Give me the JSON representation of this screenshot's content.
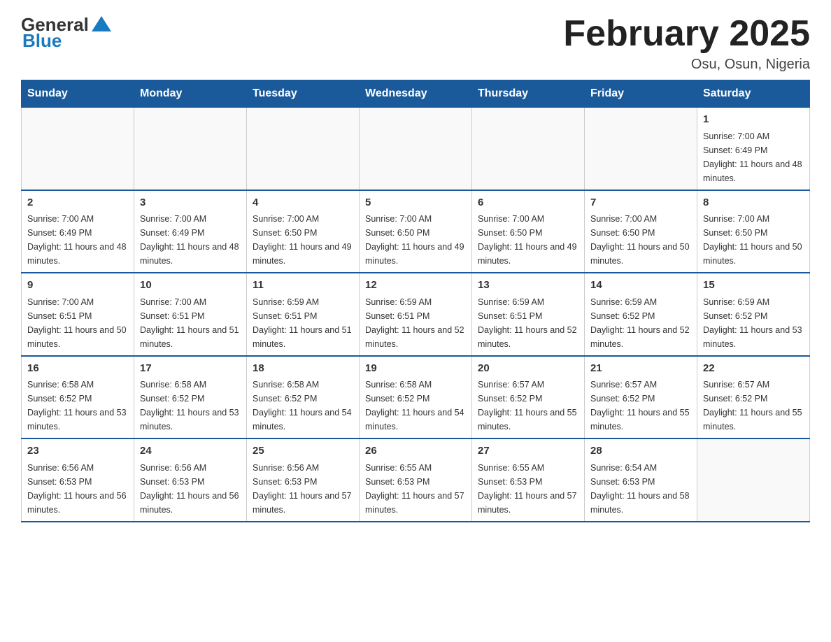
{
  "logo": {
    "general": "General",
    "blue": "Blue"
  },
  "title": "February 2025",
  "subtitle": "Osu, Osun, Nigeria",
  "days": [
    "Sunday",
    "Monday",
    "Tuesday",
    "Wednesday",
    "Thursday",
    "Friday",
    "Saturday"
  ],
  "weeks": [
    [
      {
        "day": "",
        "sunrise": "",
        "sunset": "",
        "daylight": ""
      },
      {
        "day": "",
        "sunrise": "",
        "sunset": "",
        "daylight": ""
      },
      {
        "day": "",
        "sunrise": "",
        "sunset": "",
        "daylight": ""
      },
      {
        "day": "",
        "sunrise": "",
        "sunset": "",
        "daylight": ""
      },
      {
        "day": "",
        "sunrise": "",
        "sunset": "",
        "daylight": ""
      },
      {
        "day": "",
        "sunrise": "",
        "sunset": "",
        "daylight": ""
      },
      {
        "day": "1",
        "sunrise": "Sunrise: 7:00 AM",
        "sunset": "Sunset: 6:49 PM",
        "daylight": "Daylight: 11 hours and 48 minutes."
      }
    ],
    [
      {
        "day": "2",
        "sunrise": "Sunrise: 7:00 AM",
        "sunset": "Sunset: 6:49 PM",
        "daylight": "Daylight: 11 hours and 48 minutes."
      },
      {
        "day": "3",
        "sunrise": "Sunrise: 7:00 AM",
        "sunset": "Sunset: 6:49 PM",
        "daylight": "Daylight: 11 hours and 48 minutes."
      },
      {
        "day": "4",
        "sunrise": "Sunrise: 7:00 AM",
        "sunset": "Sunset: 6:50 PM",
        "daylight": "Daylight: 11 hours and 49 minutes."
      },
      {
        "day": "5",
        "sunrise": "Sunrise: 7:00 AM",
        "sunset": "Sunset: 6:50 PM",
        "daylight": "Daylight: 11 hours and 49 minutes."
      },
      {
        "day": "6",
        "sunrise": "Sunrise: 7:00 AM",
        "sunset": "Sunset: 6:50 PM",
        "daylight": "Daylight: 11 hours and 49 minutes."
      },
      {
        "day": "7",
        "sunrise": "Sunrise: 7:00 AM",
        "sunset": "Sunset: 6:50 PM",
        "daylight": "Daylight: 11 hours and 50 minutes."
      },
      {
        "day": "8",
        "sunrise": "Sunrise: 7:00 AM",
        "sunset": "Sunset: 6:50 PM",
        "daylight": "Daylight: 11 hours and 50 minutes."
      }
    ],
    [
      {
        "day": "9",
        "sunrise": "Sunrise: 7:00 AM",
        "sunset": "Sunset: 6:51 PM",
        "daylight": "Daylight: 11 hours and 50 minutes."
      },
      {
        "day": "10",
        "sunrise": "Sunrise: 7:00 AM",
        "sunset": "Sunset: 6:51 PM",
        "daylight": "Daylight: 11 hours and 51 minutes."
      },
      {
        "day": "11",
        "sunrise": "Sunrise: 6:59 AM",
        "sunset": "Sunset: 6:51 PM",
        "daylight": "Daylight: 11 hours and 51 minutes."
      },
      {
        "day": "12",
        "sunrise": "Sunrise: 6:59 AM",
        "sunset": "Sunset: 6:51 PM",
        "daylight": "Daylight: 11 hours and 52 minutes."
      },
      {
        "day": "13",
        "sunrise": "Sunrise: 6:59 AM",
        "sunset": "Sunset: 6:51 PM",
        "daylight": "Daylight: 11 hours and 52 minutes."
      },
      {
        "day": "14",
        "sunrise": "Sunrise: 6:59 AM",
        "sunset": "Sunset: 6:52 PM",
        "daylight": "Daylight: 11 hours and 52 minutes."
      },
      {
        "day": "15",
        "sunrise": "Sunrise: 6:59 AM",
        "sunset": "Sunset: 6:52 PM",
        "daylight": "Daylight: 11 hours and 53 minutes."
      }
    ],
    [
      {
        "day": "16",
        "sunrise": "Sunrise: 6:58 AM",
        "sunset": "Sunset: 6:52 PM",
        "daylight": "Daylight: 11 hours and 53 minutes."
      },
      {
        "day": "17",
        "sunrise": "Sunrise: 6:58 AM",
        "sunset": "Sunset: 6:52 PM",
        "daylight": "Daylight: 11 hours and 53 minutes."
      },
      {
        "day": "18",
        "sunrise": "Sunrise: 6:58 AM",
        "sunset": "Sunset: 6:52 PM",
        "daylight": "Daylight: 11 hours and 54 minutes."
      },
      {
        "day": "19",
        "sunrise": "Sunrise: 6:58 AM",
        "sunset": "Sunset: 6:52 PM",
        "daylight": "Daylight: 11 hours and 54 minutes."
      },
      {
        "day": "20",
        "sunrise": "Sunrise: 6:57 AM",
        "sunset": "Sunset: 6:52 PM",
        "daylight": "Daylight: 11 hours and 55 minutes."
      },
      {
        "day": "21",
        "sunrise": "Sunrise: 6:57 AM",
        "sunset": "Sunset: 6:52 PM",
        "daylight": "Daylight: 11 hours and 55 minutes."
      },
      {
        "day": "22",
        "sunrise": "Sunrise: 6:57 AM",
        "sunset": "Sunset: 6:52 PM",
        "daylight": "Daylight: 11 hours and 55 minutes."
      }
    ],
    [
      {
        "day": "23",
        "sunrise": "Sunrise: 6:56 AM",
        "sunset": "Sunset: 6:53 PM",
        "daylight": "Daylight: 11 hours and 56 minutes."
      },
      {
        "day": "24",
        "sunrise": "Sunrise: 6:56 AM",
        "sunset": "Sunset: 6:53 PM",
        "daylight": "Daylight: 11 hours and 56 minutes."
      },
      {
        "day": "25",
        "sunrise": "Sunrise: 6:56 AM",
        "sunset": "Sunset: 6:53 PM",
        "daylight": "Daylight: 11 hours and 57 minutes."
      },
      {
        "day": "26",
        "sunrise": "Sunrise: 6:55 AM",
        "sunset": "Sunset: 6:53 PM",
        "daylight": "Daylight: 11 hours and 57 minutes."
      },
      {
        "day": "27",
        "sunrise": "Sunrise: 6:55 AM",
        "sunset": "Sunset: 6:53 PM",
        "daylight": "Daylight: 11 hours and 57 minutes."
      },
      {
        "day": "28",
        "sunrise": "Sunrise: 6:54 AM",
        "sunset": "Sunset: 6:53 PM",
        "daylight": "Daylight: 11 hours and 58 minutes."
      },
      {
        "day": "",
        "sunrise": "",
        "sunset": "",
        "daylight": ""
      }
    ]
  ]
}
